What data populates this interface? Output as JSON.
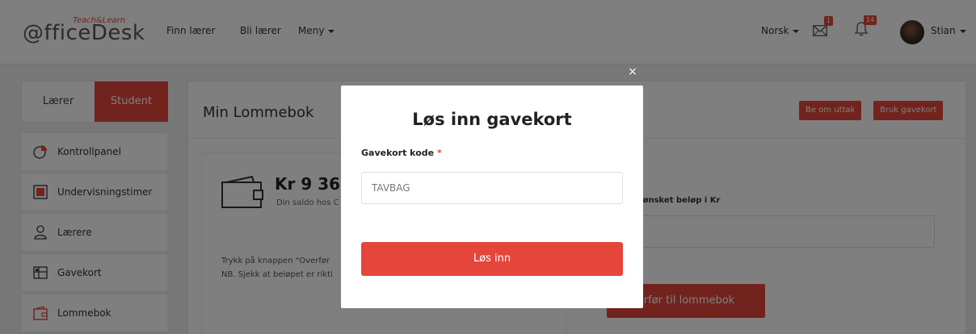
{
  "brand": {
    "logo_main": "@fficeDesk",
    "logo_sup": "Teach&Learn"
  },
  "nav": {
    "links": [
      {
        "label": "Finn lærer"
      },
      {
        "label": "Bli lærer"
      },
      {
        "label": "Meny"
      }
    ],
    "language": "Norsk",
    "messages_badge": "1",
    "notifications_badge": "14",
    "user_name": "Stian"
  },
  "sidebar": {
    "role_tabs": [
      "Lærer",
      "Student"
    ],
    "active_role": "Student",
    "items": [
      {
        "label": "Kontrollpanel",
        "icon": "chart-icon"
      },
      {
        "label": "Undervisningstimer",
        "icon": "lesson-icon"
      },
      {
        "label": "Lærere",
        "icon": "user-icon"
      },
      {
        "label": "Gavekort",
        "icon": "giftcard-icon"
      },
      {
        "label": "Lommebok",
        "icon": "wallet-icon"
      }
    ]
  },
  "main": {
    "title": "Min Lommebok",
    "withdraw_button": "Be om uttak",
    "use_giftcard_button": "Bruk gavekort",
    "balance": "Kr 9 36",
    "balance_sub": "Din saldo hos C",
    "info_line1": "Trykk på knappen \"Overfør",
    "info_line2": "NB. Sjekk at beløpet er rikti",
    "transfer_label": "n ønsket beløp i Kr",
    "transfer_button": "erfør til lommebok"
  },
  "modal": {
    "close_symbol": "×",
    "title": "Løs inn gavekort",
    "field_label": "Gavekort kode",
    "required_mark": "*",
    "code_value": "TAVBAG",
    "submit_label": "Løs inn"
  },
  "colors": {
    "accent": "#e5463b",
    "overlay": "rgba(0,0,0,0.5)"
  }
}
